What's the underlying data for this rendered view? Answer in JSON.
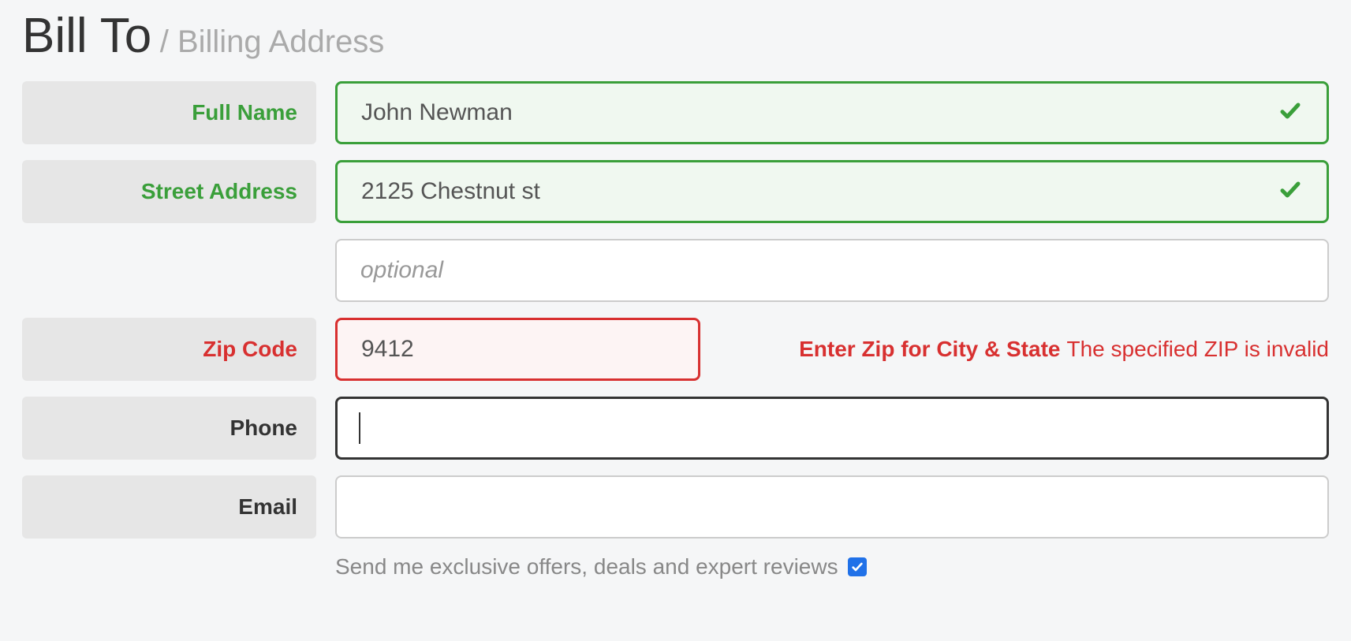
{
  "heading": {
    "main": "Bill To",
    "sub": "/ Billing Address"
  },
  "fields": {
    "fullName": {
      "label": "Full Name",
      "value": "John Newman"
    },
    "street": {
      "label": "Street Address",
      "value": "2125 Chestnut st"
    },
    "street2": {
      "placeholder": "optional",
      "value": ""
    },
    "zip": {
      "label": "Zip Code",
      "value": "9412",
      "hintBold": "Enter Zip for City & State",
      "hintNormal": "The specified ZIP is invalid"
    },
    "phone": {
      "label": "Phone",
      "value": ""
    },
    "email": {
      "label": "Email",
      "value": ""
    }
  },
  "optin": {
    "label": "Send me exclusive offers, deals and expert reviews",
    "checked": true
  }
}
